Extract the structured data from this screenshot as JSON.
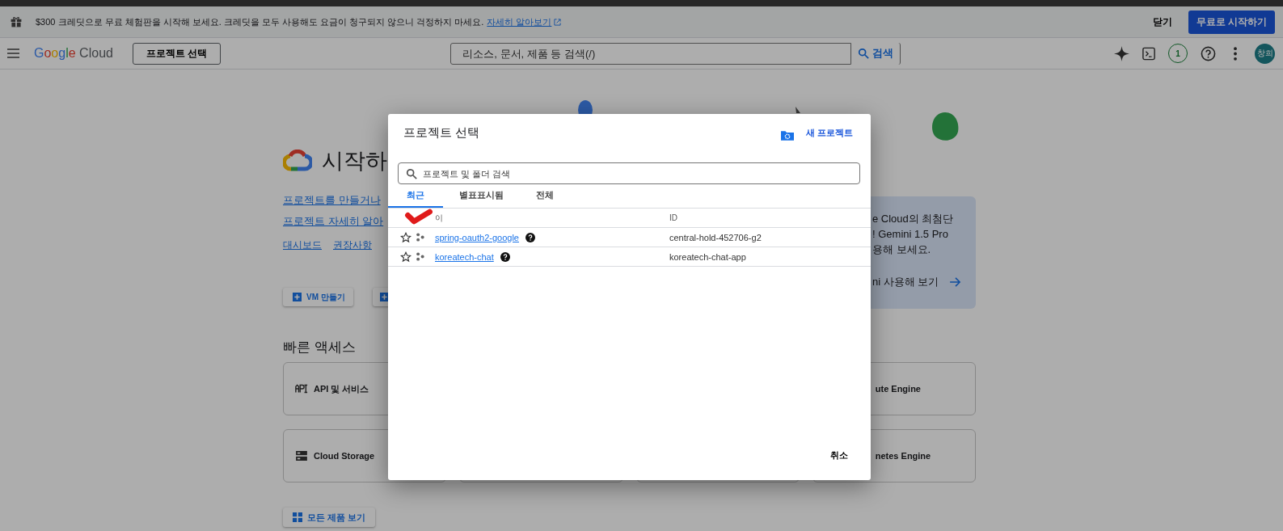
{
  "banner": {
    "text": "$300 크레딧으로 무료 체험판을 시작해 보세요. 크레딧을 모두 사용해도 요금이 청구되지 않으니 걱정하지 마세요.",
    "link": "자세히 알아보기",
    "close": "닫기",
    "cta": "무료로 시작하기"
  },
  "header": {
    "logo": "Google Cloud",
    "project_button": "프로젝트 선택",
    "search": {
      "placeholder": "리소스, 문서, 제품 등 검색(/)"
    },
    "search_button": "검색",
    "notifications": "1",
    "avatar": "창희"
  },
  "main": {
    "title": "시작하",
    "links": [
      "프로젝트를 만들거나",
      "프로젝트 자세히 알아"
    ],
    "nav_links": [
      "대시보드",
      "권장사항"
    ],
    "buttons": [
      {
        "label": "VM 만들기"
      },
      {
        "kind": "cut"
      }
    ],
    "promo": {
      "lines": [
        "e Cloud의 최첨단",
        "! Gemini 1.5 Pro",
        "용해 보세요."
      ],
      "action": "ni 사용해 보기"
    },
    "quick_access_title": "빠른 액세스",
    "cards": [
      {
        "kind": "api",
        "label": "API 및 서비스"
      },
      {
        "kind": "cut",
        "label": "ute Engine"
      },
      {
        "kind": "storage",
        "label": "Cloud Storage"
      },
      {
        "kind": "empty"
      },
      {
        "kind": "empty"
      },
      {
        "kind": "cut",
        "label": "netes Engine"
      }
    ],
    "all_products": "모든 제품 보기"
  },
  "dialog": {
    "title": "프로젝트 선택",
    "new_project": "새 프로젝트",
    "search": {
      "placeholder": "프로젝트 및 폴더 검색"
    },
    "tabs": [
      {
        "label": "최근",
        "selected": true
      },
      {
        "label": "별표표시됨",
        "selected": false
      },
      {
        "label": "전체",
        "selected": false
      }
    ],
    "columns": [
      "이",
      "ID"
    ],
    "rows": [
      {
        "name": "spring-oauth2-google",
        "id": "central-hold-452706-g2",
        "starred": false
      },
      {
        "name": "koreatech-chat",
        "id": "koreatech-chat-app",
        "starred": false
      }
    ],
    "cancel": "취소"
  }
}
